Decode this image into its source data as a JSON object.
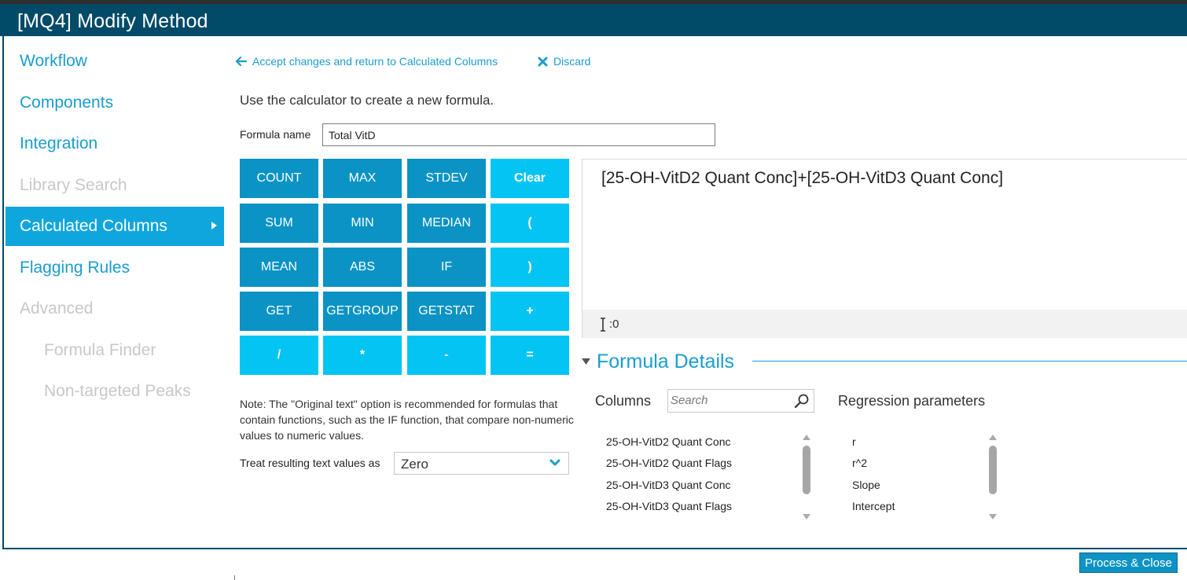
{
  "window": {
    "title": "[MQ4] Modify Method"
  },
  "sidebar": {
    "items": [
      {
        "label": "Workflow"
      },
      {
        "label": "Components"
      },
      {
        "label": "Integration"
      },
      {
        "label": "Library Search"
      },
      {
        "label": "Calculated Columns"
      },
      {
        "label": "Flagging Rules"
      },
      {
        "label": "Advanced"
      },
      {
        "label": "Formula Finder"
      },
      {
        "label": "Non-targeted Peaks"
      }
    ]
  },
  "actions": {
    "accept_label": "Accept changes and return to Calculated Columns",
    "discard_label": "Discard"
  },
  "instructions": "Use the calculator to create a new formula.",
  "formula_name": {
    "label": "Formula name",
    "value": "Total VitD"
  },
  "calculator": {
    "buttons": [
      "COUNT",
      "MAX",
      "STDEV",
      "Clear",
      "SUM",
      "MIN",
      "MEDIAN",
      "(",
      "MEAN",
      "ABS",
      "IF",
      ")",
      "GET",
      "GETGROUP",
      "GETSTAT",
      "+",
      "/",
      "*",
      "-",
      "="
    ]
  },
  "formula": {
    "text": "[25-OH-VitD2 Quant Conc]+[25-OH-VitD3 Quant Conc]",
    "cursor_position": ":0"
  },
  "note": "Note: The \"Original text\" option is recommended for formulas that contain functions, such as the IF function, that compare non-numeric values to numeric values.",
  "treat_text": {
    "label": "Treat resulting text values as",
    "value": "Zero"
  },
  "formula_details": {
    "title": "Formula Details",
    "columns_label": "Columns",
    "search_placeholder": "Search",
    "regression_label": "Regression parameters",
    "columns": [
      "25-OH-VitD2 Quant Conc",
      "25-OH-VitD2 Quant Flags",
      "25-OH-VitD3 Quant Conc",
      "25-OH-VitD3 Quant Flags"
    ],
    "regression_params": [
      "r",
      "r^2",
      "Slope",
      "Intercept"
    ]
  },
  "footer": {
    "process_close_label": "Process & Close"
  },
  "colors": {
    "title_bar": "#014a68",
    "accent": "#1a9dce",
    "function_button": "#0a93c4",
    "operator_button": "#04c4f3"
  }
}
